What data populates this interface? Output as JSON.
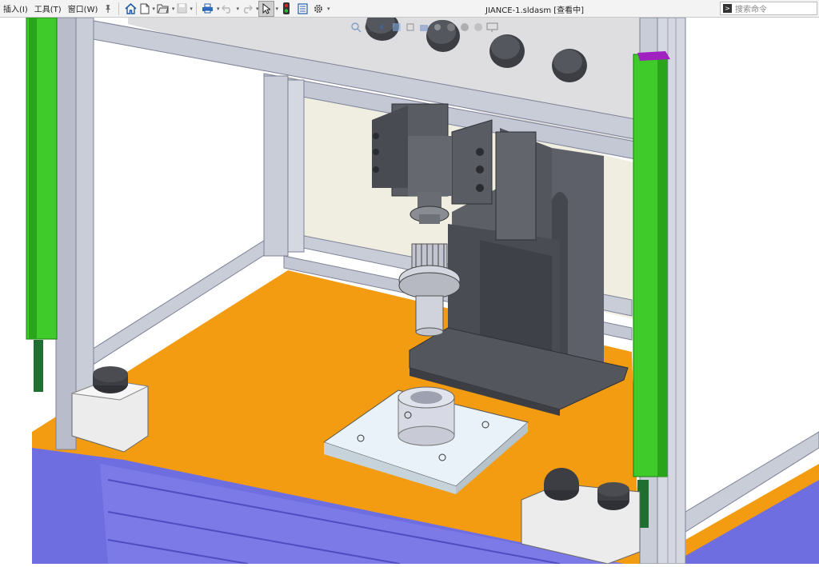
{
  "menu": {
    "insert": "插入(I)",
    "tools": "工具(T)",
    "window": "窗口(W)"
  },
  "toolbar": {
    "icons": [
      "pin-icon",
      "home-icon",
      "new-document-icon",
      "open-folder-icon",
      "save-icon",
      "print-icon",
      "undo-icon",
      "redo-icon",
      "select-pointer-icon",
      "rebuild-traffic-light-icon",
      "file-properties-icon",
      "options-gear-icon"
    ]
  },
  "document": {
    "title": "JIANCE-1.sldasm [查看中]"
  },
  "search": {
    "placeholder": "搜索命令"
  },
  "colors": {
    "frame": "#c9cdd8",
    "frame_edge": "#7c8196",
    "table_top": "#f39c12",
    "base_panel": "#6f6ee0",
    "light_curtain": "#3fcb2a",
    "machine_body": "#54565e",
    "wall_back": "#f2f0e4",
    "upper_panel": "#d9d9dc"
  }
}
